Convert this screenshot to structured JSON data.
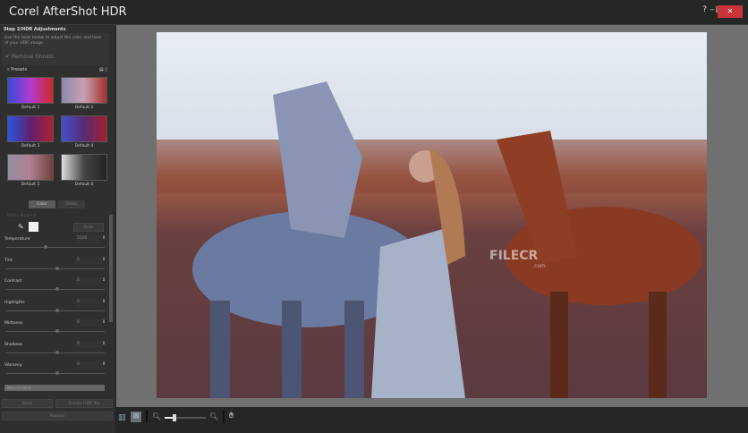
{
  "app": {
    "title": "Corel AfterShot HDR",
    "help": "?",
    "minimize": "–",
    "restore": "▣",
    "close": "✕"
  },
  "panel": {
    "step": "Step 2/HDR Adjustments",
    "description": "Use the tools below to adjust the color and tone of your HDR image.",
    "remove_ghosts": "Remove Ghosts",
    "presets_label": "Presets",
    "presets": [
      {
        "label": "Default 1"
      },
      {
        "label": "Default 2"
      },
      {
        "label": "Default 3"
      },
      {
        "label": "Default 4"
      },
      {
        "label": "Default 5"
      },
      {
        "label": "Default 6"
      }
    ],
    "tabs": [
      {
        "label": "Color"
      },
      {
        "label": "Detail"
      }
    ],
    "white_balance": "White Balance",
    "auto": "Auto",
    "sliders": [
      {
        "label": "Temperature",
        "value": "5500",
        "pos": 0.38
      },
      {
        "label": "Tint",
        "value": "0",
        "pos": 0.5
      },
      {
        "label": "Contrast",
        "value": "0",
        "pos": 0.5
      },
      {
        "label": "Highlights",
        "value": "0",
        "pos": 0.5
      },
      {
        "label": "Midtones",
        "value": "0",
        "pos": 0.5
      },
      {
        "label": "Shadows",
        "value": "0",
        "pos": 0.5
      },
      {
        "label": "Vibrancy",
        "value": "0",
        "pos": 0.5
      }
    ],
    "detail_dropdown": "Natural detail",
    "back": "Back",
    "create": "Create HDR file",
    "process": "Process"
  },
  "watermark": "FILECR",
  "watermark_sub": ".com",
  "zoom_level": 0.2
}
